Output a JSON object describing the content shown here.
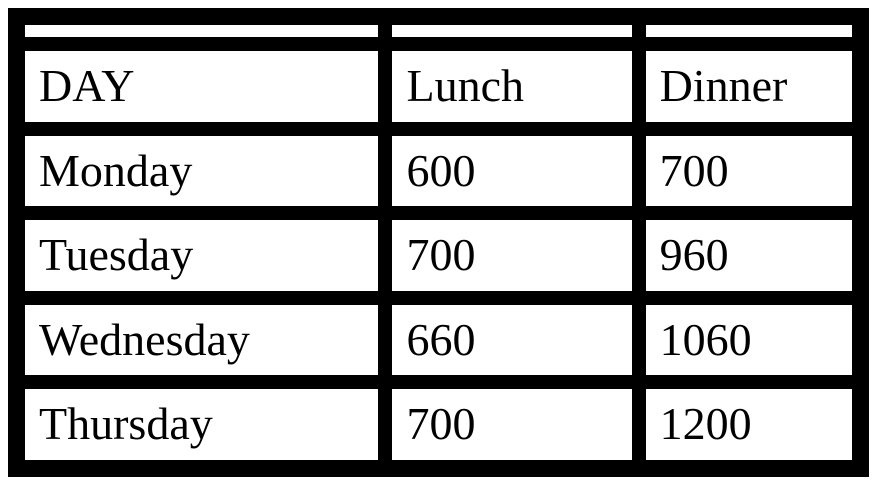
{
  "chart_data": {
    "type": "table",
    "title": "",
    "columns": [
      "DAY",
      "Lunch",
      "Dinner"
    ],
    "rows": [
      {
        "day": "Monday",
        "lunch": 600,
        "dinner": 700
      },
      {
        "day": "Tuesday",
        "lunch": 700,
        "dinner": 960
      },
      {
        "day": "Wednesday",
        "lunch": 660,
        "dinner": 1060
      },
      {
        "day": "Thursday",
        "lunch": 700,
        "dinner": 1200
      }
    ]
  },
  "table": {
    "header": {
      "day": "DAY",
      "lunch": "Lunch",
      "dinner": "Dinner"
    },
    "rows": [
      {
        "day": "Monday",
        "lunch": "600",
        "dinner": "700"
      },
      {
        "day": "Tuesday",
        "lunch": "700",
        "dinner": "960"
      },
      {
        "day": "Wednesday",
        "lunch": "660",
        "dinner": "1060"
      },
      {
        "day": "Thursday",
        "lunch": "700",
        "dinner": "1200"
      }
    ]
  }
}
